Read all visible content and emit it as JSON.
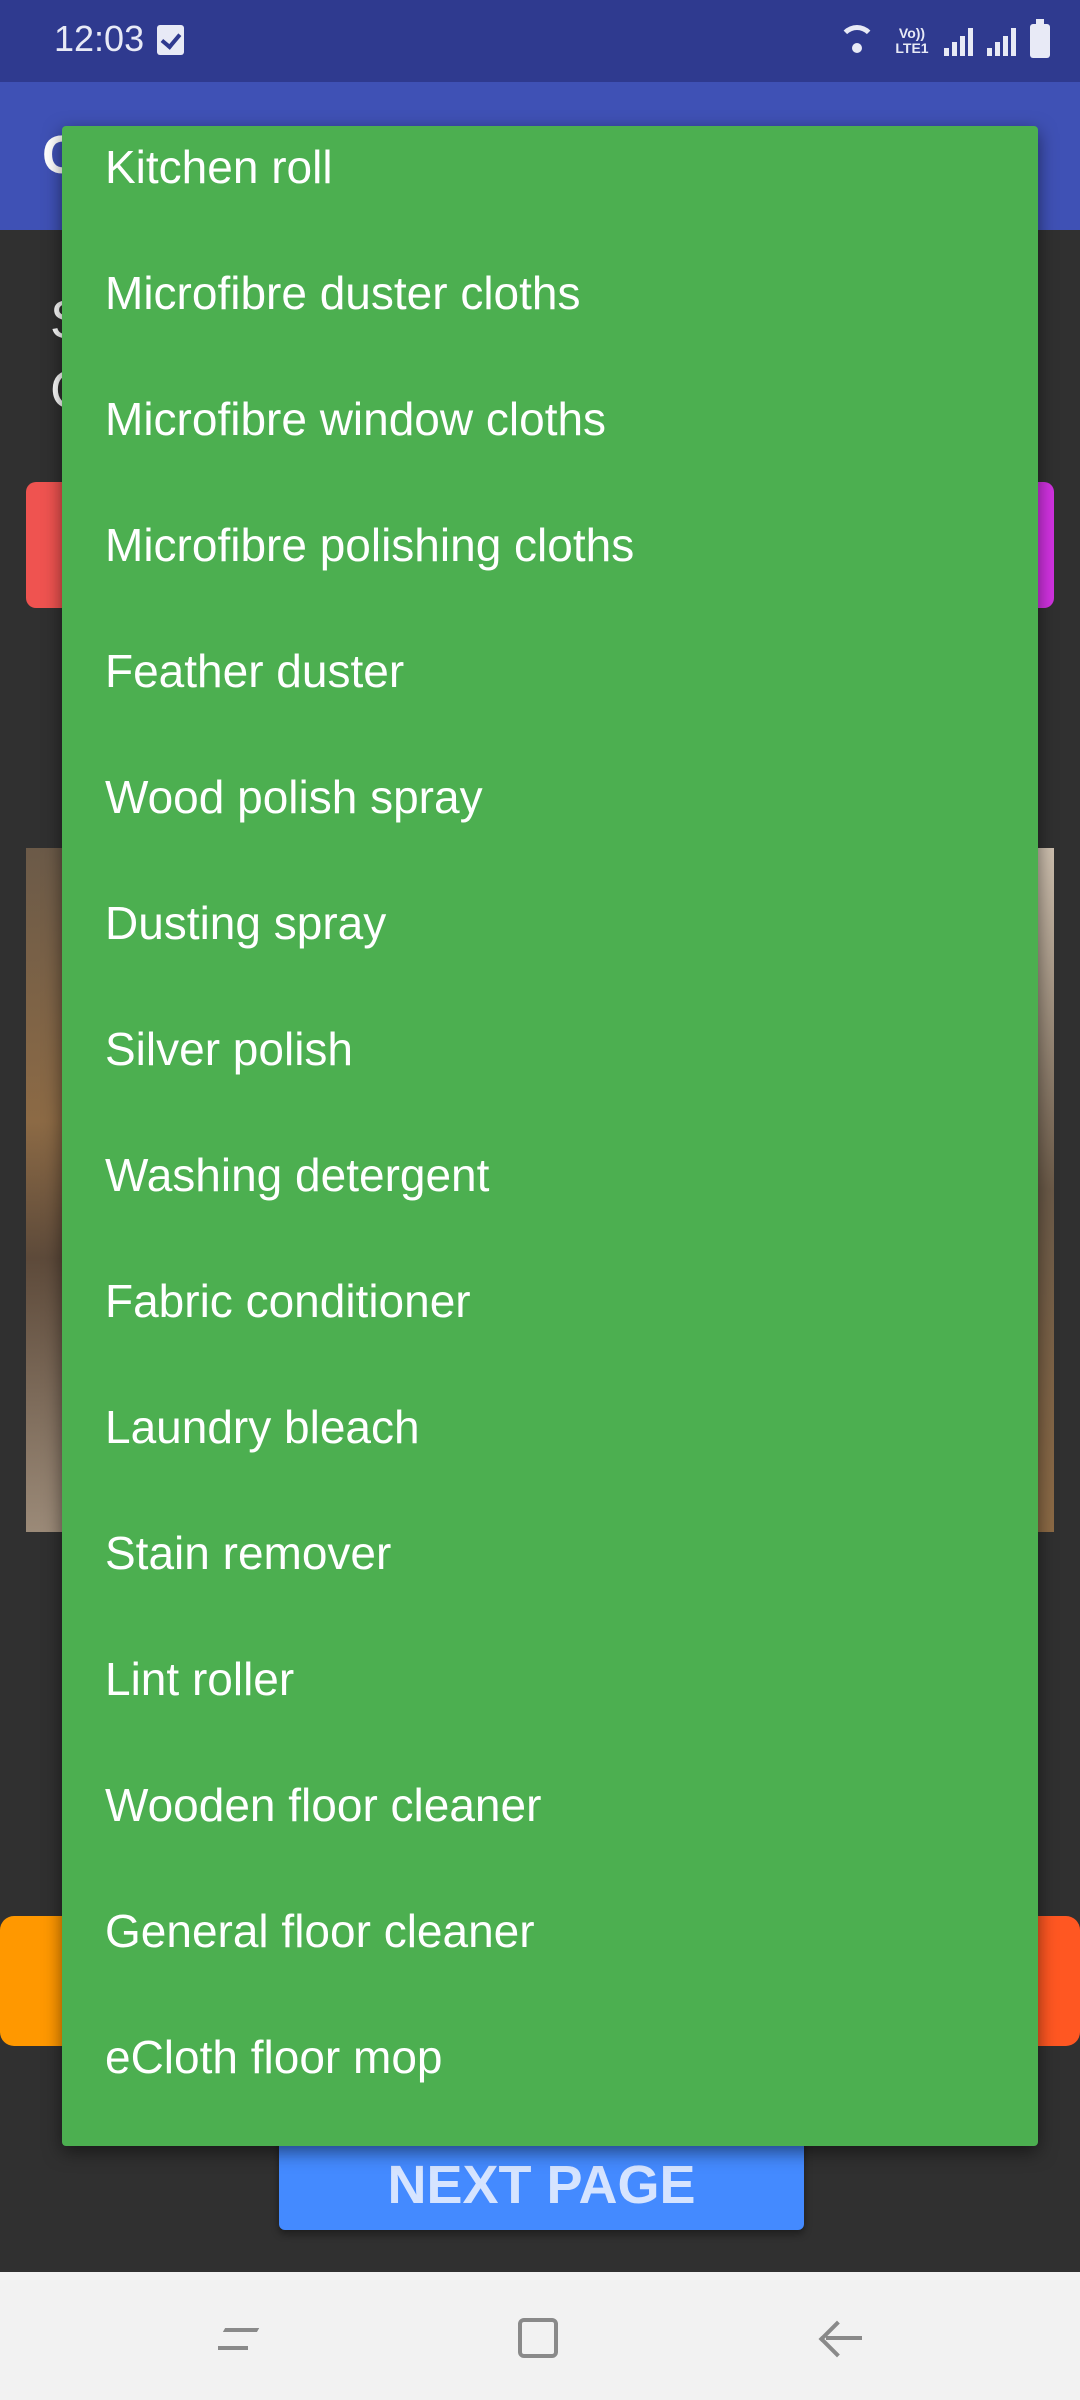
{
  "status_bar": {
    "time": "12:03",
    "lte_label": "Vo)) LTE1",
    "icons": [
      "checkbox-notification-icon",
      "wifi-icon",
      "signal-icon",
      "signal-icon",
      "battery-icon"
    ]
  },
  "app_bar": {
    "title": "C"
  },
  "background": {
    "text": "S\nC",
    "next_button_label": "NEXT PAGE"
  },
  "dropdown": {
    "items": [
      "Kitchen roll",
      "Microfibre duster cloths",
      "Microfibre window cloths",
      "Microfibre polishing cloths",
      "Feather duster",
      "Wood polish spray",
      "Dusting spray",
      "Silver polish",
      "Washing detergent",
      "Fabric conditioner",
      "Laundry bleach",
      "Stain remover",
      "Lint roller",
      "Wooden floor cleaner",
      "General floor cleaner",
      "eCloth floor mop"
    ]
  },
  "nav_bar": {
    "icons": [
      "recent-apps-icon",
      "home-icon",
      "back-icon"
    ]
  },
  "colors": {
    "status_bar": "#2f3a8f",
    "app_bar": "#3f51b5",
    "dropdown": "#4caf50",
    "next_button": "#448aff",
    "background": "#303030"
  }
}
